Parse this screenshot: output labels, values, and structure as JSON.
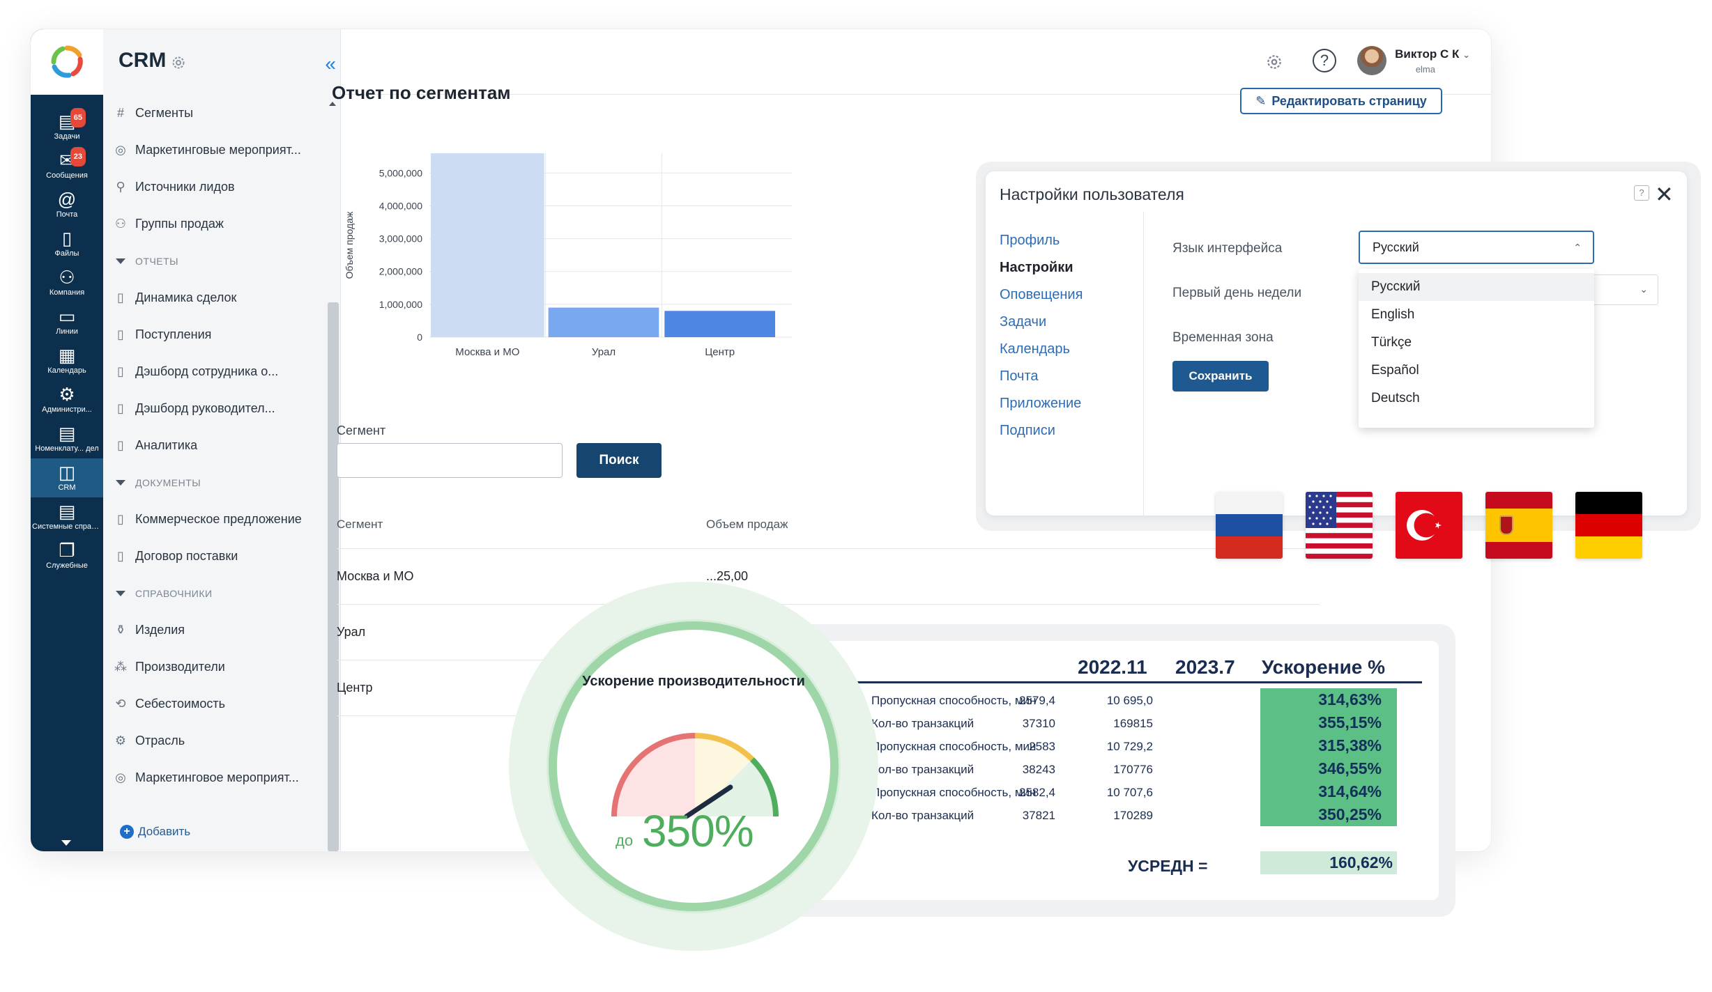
{
  "app": {
    "title": "CRM"
  },
  "rail": {
    "items": [
      {
        "label": "Задачи",
        "icon": "tasks-icon",
        "badge": "65"
      },
      {
        "label": "Сообщения",
        "icon": "messages-icon",
        "badge": "23"
      },
      {
        "label": "Почта",
        "icon": "mail-icon"
      },
      {
        "label": "Файлы",
        "icon": "files-icon"
      },
      {
        "label": "Компания",
        "icon": "company-icon"
      },
      {
        "label": "Линии",
        "icon": "lines-icon"
      },
      {
        "label": "Календарь",
        "icon": "calendar-icon"
      },
      {
        "label": "Администри...",
        "icon": "admin-gear-icon"
      },
      {
        "label": "Номенклату... дел",
        "icon": "nomenclature-icon"
      },
      {
        "label": "CRM",
        "icon": "crm-icon"
      },
      {
        "label": "Системные справочники",
        "icon": "system-directories-icon"
      },
      {
        "label": "Служебные",
        "icon": "service-icon"
      }
    ]
  },
  "sidebar": {
    "items": [
      {
        "type": "item",
        "label": "Сегменты",
        "icon": "hash-icon"
      },
      {
        "type": "item",
        "label": "Маркетинговые мероприят...",
        "icon": "target-icon"
      },
      {
        "type": "item",
        "label": "Источники лидов",
        "icon": "sources-icon"
      },
      {
        "type": "item",
        "label": "Группы продаж",
        "icon": "group-icon"
      },
      {
        "type": "group",
        "label": "ОТЧЕТЫ"
      },
      {
        "type": "item",
        "label": "Динамика сделок",
        "icon": "document-icon"
      },
      {
        "type": "item",
        "label": "Поступления",
        "icon": "document-icon"
      },
      {
        "type": "item",
        "label": "Дэшборд сотрудника о...",
        "icon": "document-icon"
      },
      {
        "type": "item",
        "label": "Дэшборд руководител...",
        "icon": "document-icon"
      },
      {
        "type": "item",
        "label": "Аналитика",
        "icon": "document-icon"
      },
      {
        "type": "group",
        "label": "ДОКУМЕНТЫ"
      },
      {
        "type": "item",
        "label": "Коммерческое предложение",
        "icon": "document-icon"
      },
      {
        "type": "item",
        "label": "Договор поставки",
        "icon": "document-icon"
      },
      {
        "type": "group",
        "label": "СПРАВОЧНИКИ"
      },
      {
        "type": "item",
        "label": "Изделия",
        "icon": "product-icon"
      },
      {
        "type": "item",
        "label": "Производители",
        "icon": "manufacturer-icon"
      },
      {
        "type": "item",
        "label": "Себестоимость",
        "icon": "cost-icon"
      },
      {
        "type": "item",
        "label": "Отрасль",
        "icon": "industry-icon"
      },
      {
        "type": "item",
        "label": "Маркетинговое мероприят...",
        "icon": "target-icon"
      }
    ],
    "add_label": "Добавить"
  },
  "header": {
    "user_name": "Виктор С К",
    "user_sub": "elma"
  },
  "page": {
    "title": "Отчет по сегментам",
    "edit_button": "Редактировать страницу",
    "segment_label": "Сегмент",
    "segment_value": "",
    "search_button": "Поиск",
    "table": {
      "headers": [
        "Сегмент",
        "Объем продаж"
      ],
      "rows": [
        {
          "segment": "Москва и МО",
          "volume": "...25,00"
        },
        {
          "segment": "Урал",
          "volume": ""
        },
        {
          "segment": "Центр",
          "volume": ""
        }
      ]
    }
  },
  "chart_data": {
    "type": "bar",
    "categories": [
      "Москва и МО",
      "Урал",
      "Центр"
    ],
    "values": [
      5600000,
      900000,
      800000
    ],
    "colors": [
      "#ccdcf3",
      "#79a7f0",
      "#4e86e4"
    ],
    "ylabel": "Объем продаж",
    "xlabel": "",
    "ylim": [
      0,
      5600000
    ],
    "yticks": [
      0,
      1000000,
      2000000,
      3000000,
      4000000,
      5000000
    ],
    "ytick_labels": [
      "0",
      "1,000,000",
      "2,000,000",
      "3,000,000",
      "4,000,000",
      "5,000,000"
    ],
    "grid": true
  },
  "settings": {
    "title": "Настройки пользователя",
    "nav": [
      "Профиль",
      "Настройки",
      "Оповещения",
      "Задачи",
      "Календарь",
      "Почта",
      "Приложение",
      "Подписи"
    ],
    "active_nav": 1,
    "fields": {
      "language": "Язык интерфейса",
      "week_start": "Первый день недели",
      "timezone": "Временная зона"
    },
    "language_value": "Русский",
    "language_options": [
      "Русский",
      "English",
      "Türkçe",
      "Español",
      "Deutsch"
    ],
    "save_button": "Сохранить",
    "help": "?"
  },
  "flags": [
    "russia-flag",
    "usa-flag",
    "turkey-flag",
    "spain-flag",
    "germany-flag"
  ],
  "performance": {
    "headers": [
      "2022.11",
      "2023.7",
      "Ускорение %"
    ],
    "rows": [
      {
        "label": "Пропускная способность, мин",
        "a": "2579,4",
        "b": "10 695,0",
        "c": "314,63%"
      },
      {
        "label": "Кол-во транзакций",
        "a": "37310",
        "b": "169815",
        "c": "355,15%"
      },
      {
        "label": "Пропускная способность, мин",
        "a": "2583",
        "b": "10 729,2",
        "c": "315,38%"
      },
      {
        "label": "Кол-во транзакций",
        "a": "38243",
        "b": "170776",
        "c": "346,55%"
      },
      {
        "label": "Пропускная способность, мин",
        "a": "2582,4",
        "b": "10 707,6",
        "c": "314,64%"
      },
      {
        "label": "Кол-во транзакций",
        "a": "37821",
        "b": "170289",
        "c": "350,25%"
      }
    ],
    "avg_label": "УСРЕДН =",
    "avg_value": "160,62%",
    "highlight_color": "#5cbf85"
  },
  "gauge": {
    "title": "Ускорение производительности",
    "prefix": "до",
    "value": "350%",
    "level": 0.78
  }
}
